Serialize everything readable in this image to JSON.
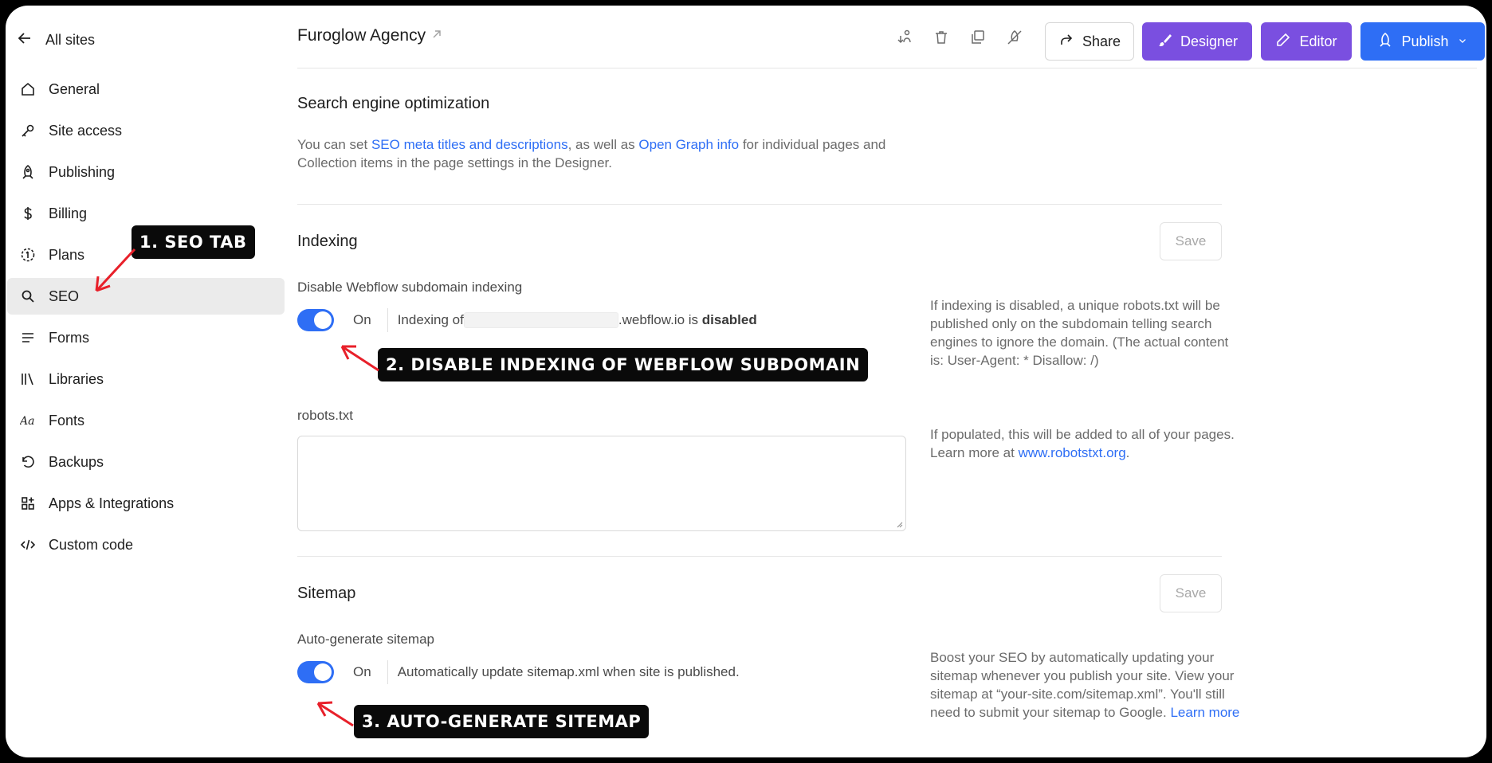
{
  "sidebar": {
    "back_label": "All sites",
    "items": [
      {
        "label": "General",
        "icon": "home-icon"
      },
      {
        "label": "Site access",
        "icon": "key-icon"
      },
      {
        "label": "Publishing",
        "icon": "rocket-icon"
      },
      {
        "label": "Billing",
        "icon": "dollar-icon"
      },
      {
        "label": "Plans",
        "icon": "plans-icon"
      },
      {
        "label": "SEO",
        "icon": "search-icon",
        "active": true
      },
      {
        "label": "Forms",
        "icon": "forms-icon"
      },
      {
        "label": "Libraries",
        "icon": "libraries-icon"
      },
      {
        "label": "Fonts",
        "icon": "fonts-icon"
      },
      {
        "label": "Backups",
        "icon": "backups-icon"
      },
      {
        "label": "Apps & Integrations",
        "icon": "apps-icon"
      },
      {
        "label": "Custom code",
        "icon": "code-icon"
      }
    ]
  },
  "header": {
    "site_name": "Furoglow Agency",
    "share_label": "Share",
    "designer_label": "Designer",
    "editor_label": "Editor",
    "publish_label": "Publish"
  },
  "seo": {
    "title": "Search engine optimization",
    "text_prefix": "You can set ",
    "link1": "SEO meta titles and descriptions",
    "text_mid": ", as well as ",
    "link2": "Open Graph info",
    "text_suffix": " for individual pages and Collection items in the page settings in the Designer."
  },
  "indexing": {
    "title": "Indexing",
    "save_label": "Save",
    "toggle_label": "Disable Webflow subdomain indexing",
    "toggle_state": "On",
    "status_prefix": "Indexing of",
    "status_domain": ".webflow.io is",
    "status_value": "disabled",
    "note": "If indexing is disabled, a unique robots.txt will be published only on the subdomain telling search engines to ignore the domain. (The actual content is: User-Agent: * Disallow: /)",
    "robots_label": "robots.txt",
    "robots_value": "",
    "robots_note_prefix": "If populated, this will be added to all of your pages. Learn more at ",
    "robots_note_link": "www.robotstxt.org",
    "robots_note_suffix": "."
  },
  "sitemap": {
    "title": "Sitemap",
    "save_label": "Save",
    "toggle_label": "Auto-generate sitemap",
    "toggle_state": "On",
    "status": "Automatically update sitemap.xml when site is published.",
    "note_prefix": "Boost your SEO by automatically updating your sitemap whenever you publish your site. View your sitemap at “your-site.com/sitemap.xml”. You'll still need to submit your sitemap to Google. ",
    "note_link": "Learn more"
  },
  "annotations": {
    "a1": "1. SEO TAB",
    "a2": "2. DISABLE INDEXING OF WEBFLOW SUBDOMAIN",
    "a3": "3. AUTO-GENERATE SITEMAP"
  },
  "colors": {
    "accent_blue": "#2e6ef5",
    "accent_purple": "#7a4fe0",
    "annotation_arrow": "#e8202a"
  }
}
